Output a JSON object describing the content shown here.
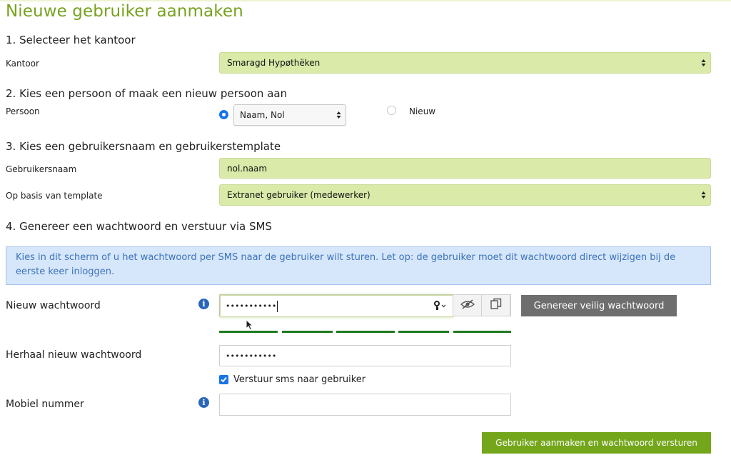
{
  "page": {
    "title": "Nieuwe gebruiker aanmaken"
  },
  "section1": {
    "title": "1. Selecteer het kantoor",
    "kantoor_label": "Kantoor",
    "kantoor_value": "Smaragd Hypøthëken"
  },
  "section2": {
    "title": "2. Kies een persoon of maak een nieuw persoon aan",
    "persoon_label": "Persoon",
    "persoon_value": "Naam, Nol",
    "nieuw_label": "Nieuw",
    "selected_option": "existing"
  },
  "section3": {
    "title": "3. Kies een gebruikersnaam en gebruikerstemplate",
    "username_label": "Gebruikersnaam",
    "username_value": "nol.naam",
    "template_label": "Op basis van template",
    "template_value": "Extranet gebruiker (medewerker)"
  },
  "section4": {
    "title": "4. Genereer een wachtwoord en verstuur via SMS",
    "info_text": "Kies in dit scherm of u het wachtwoord per SMS naar de gebruiker wilt sturen. Let op: de gebruiker moet dit wachtwoord direct wijzigen bij de eerste keer inloggen.",
    "new_password_label": "Nieuw wachtwoord",
    "new_password_value": "•••••••••••",
    "generate_button": "Genereer veilig wachtwoord",
    "strength_segments_filled": 5,
    "strength_segments_total": 5,
    "repeat_password_label": "Herhaal nieuw wachtwoord",
    "repeat_password_value": "•••••••••••",
    "sms_checkbox_label": "Verstuur sms naar gebruiker",
    "sms_checked": true,
    "mobile_label": "Mobiel nummer",
    "mobile_value": "",
    "submit_button": "Gebruiker aanmaken en wachtwoord versturen"
  },
  "icons": [
    "info-icon",
    "key-icon",
    "eye-slash-icon",
    "copy-icon",
    "select-arrows-icon",
    "mouse-cursor"
  ],
  "colors": {
    "title_green": "#76a21e",
    "field_green": "#d9eaa9",
    "info_blue_bg": "#d6e6fb",
    "info_blue_text": "#3b73b8",
    "generate_button": "#6e6e6e",
    "submit_button": "#74a61b",
    "strength_green": "#1f7a1f"
  }
}
